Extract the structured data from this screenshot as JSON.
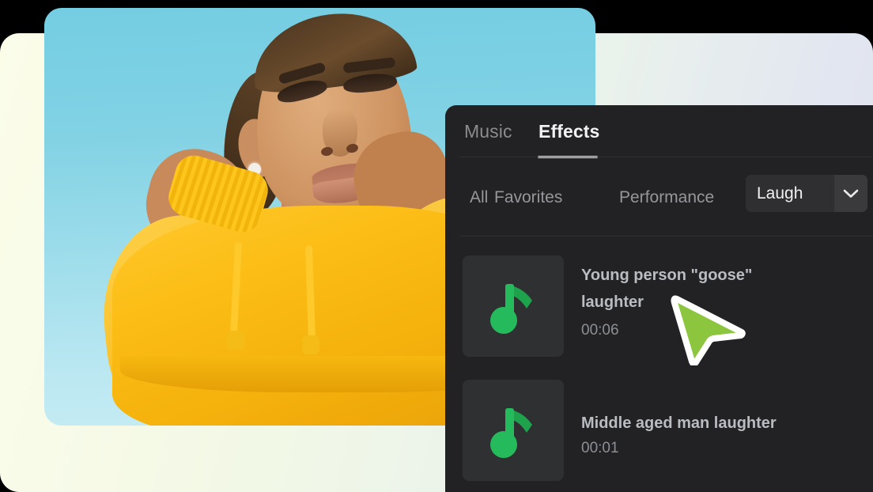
{
  "background": {
    "gradient_from": "#fbfde9",
    "gradient_to": "#dfe2ef"
  },
  "photo": {
    "alt_description": "Woman in a cropped yellow hoodie against a cyan sky",
    "sky_color": "#82d2e4",
    "hoodie_color": "#fcbe17"
  },
  "panel": {
    "background": "#222224",
    "tabs": [
      {
        "label": "Music",
        "active": false
      },
      {
        "label": "Effects",
        "active": true
      }
    ],
    "filters": [
      {
        "label": "All",
        "active": false
      },
      {
        "label": "Favorites",
        "active": false
      },
      {
        "label": "Performance",
        "active": false
      }
    ],
    "category_dropdown": {
      "value": "Laugh",
      "icon": "chevron-down-icon",
      "chip_bg": "#2f2f31",
      "arrow_bg": "#3a3a3d"
    },
    "items": [
      {
        "title": "Young person \"goose\" laughter",
        "duration": "00:06",
        "icon": "music-note-icon",
        "icon_color": "#22b757"
      },
      {
        "title": "Middle aged man laughter",
        "duration": "00:01",
        "icon": "music-note-icon",
        "icon_color": "#22b757"
      }
    ]
  },
  "cursor": {
    "icon": "arrow-pointer-icon",
    "fill": "#8cc63e",
    "stroke": "#ffffff"
  }
}
